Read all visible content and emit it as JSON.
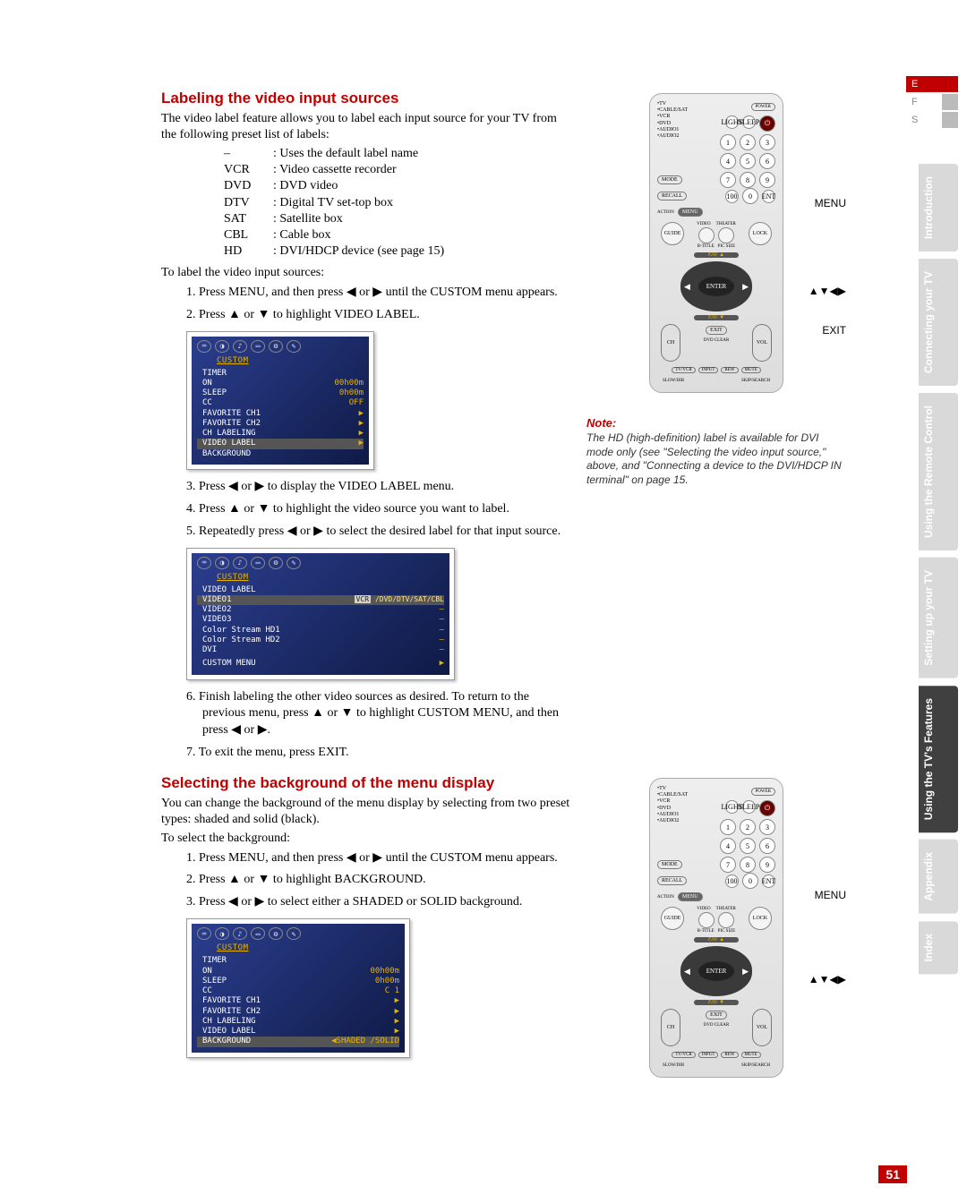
{
  "page_number": "51",
  "lang": {
    "e": "E",
    "f": "F",
    "s": "S"
  },
  "tabs": {
    "intro": "Introduction",
    "connect": "Connecting your TV",
    "remote": "Using the Remote Control",
    "setup": "Setting up your TV",
    "features": "Using the TV's Features",
    "appendix": "Appendix",
    "index": "Index"
  },
  "sec1": {
    "h": "Labeling the video input sources",
    "p": "The video label feature allows you to label each input source for your TV from the following preset list of labels:",
    "labels": [
      {
        "k": "–",
        "v": ": Uses the default label name"
      },
      {
        "k": "VCR",
        "v": ": Video cassette recorder"
      },
      {
        "k": "DVD",
        "v": ": DVD video"
      },
      {
        "k": "DTV",
        "v": ": Digital TV set-top box"
      },
      {
        "k": "SAT",
        "v": ": Satellite box"
      },
      {
        "k": "CBL",
        "v": ": Cable box"
      },
      {
        "k": "HD",
        "v": ": DVI/HDCP device (see page 15)"
      }
    ],
    "instr": "To label the video input sources:",
    "steps": {
      "s1": "1.  Press MENU, and then press ◀ or ▶ until the CUSTOM menu appears.",
      "s2": "2.  Press ▲ or ▼ to highlight VIDEO LABEL.",
      "s3": "3.  Press ◀ or ▶ to display the VIDEO LABEL menu.",
      "s4": "4.  Press ▲ or ▼ to highlight the video source you want to label.",
      "s5": "5.  Repeatedly press ◀ or ▶ to select the desired label for that input source.",
      "s6": "6.  Finish labeling the other video sources as desired. To return to the previous menu, press ▲ or ▼ to highlight CUSTOM MENU, and then press ◀ or ▶.",
      "s7": "7.  To exit the menu, press EXIT."
    }
  },
  "menu1": {
    "title": "CUSTOM",
    "lines": [
      [
        "TIMER",
        ""
      ],
      [
        "  ON",
        "00h00m"
      ],
      [
        "  SLEEP",
        "0h00m"
      ],
      [
        "CC",
        "OFF"
      ],
      [
        "FAVORITE CH1",
        "▶"
      ],
      [
        "FAVORITE CH2",
        "▶"
      ],
      [
        "CH LABELING",
        "▶"
      ],
      [
        "VIDEO LABEL",
        "▶"
      ],
      [
        "BACKGROUND",
        ""
      ]
    ],
    "highlight_index": 7
  },
  "menu2": {
    "title": "CUSTOM",
    "sub": "VIDEO   LABEL",
    "opts": "VCR /DVD/DTV/SAT/CBL",
    "lines": [
      "VIDEO1",
      "VIDEO2",
      "VIDEO3",
      "Color Stream  HD1",
      "Color Stream  HD2",
      "DVI"
    ],
    "foot": "CUSTOM MENU"
  },
  "menu3": {
    "title": "CUSTOM",
    "lines": [
      [
        "TIMER",
        ""
      ],
      [
        "  ON",
        "00h00m"
      ],
      [
        "  SLEEP",
        "0h00m"
      ],
      [
        "CC",
        "C 1"
      ],
      [
        "FAVORITE CH1",
        "▶"
      ],
      [
        "FAVORITE CH2",
        "▶"
      ],
      [
        "CH LABELING",
        "▶"
      ],
      [
        "VIDEO LABEL",
        "▶"
      ],
      [
        "BACKGROUND",
        "◀SHADED /SOLID"
      ]
    ],
    "highlight_index": 8
  },
  "remote": {
    "modes": "•TV\n•CABLE/SAT\n•VCR\n•DVD\n•AUDIO1\n•AUDIO2",
    "light": "LIGHT",
    "sleep": "SLEEP",
    "power": "POWER",
    "mode": "MODE",
    "recall": "RECALL",
    "n100": "100",
    "n0": "0",
    "ent": "ENT",
    "action": "ACTION",
    "menu_btn": "MENU",
    "video": "VIDEO",
    "theater": "THEATER",
    "guide": "GUIDE",
    "lock": "LOCK",
    "r_title": "R-TITLE",
    "size": "PIC SIZE",
    "fav": "FAV ▲",
    "enter": "ENTER",
    "fav_d": "FAV ▼",
    "ch": "CH",
    "vol": "VOL",
    "exit_b": "EXIT",
    "cap_menu": "MENU",
    "cap_arrows": "▲▼◀▶",
    "cap_exit": "EXIT",
    "dvdclear": "DVD CLEAR",
    "bottom": [
      "TV/VCR",
      "INPUT",
      "REW",
      "MUTE"
    ],
    "bottom2": [
      "SLOW/DIR",
      "",
      "SKIP/SEARCH",
      ""
    ]
  },
  "note": {
    "h": "Note:",
    "body": "The HD (high-definition) label is available for DVI mode only (see \"Selecting the video input source,\" above, and \"Connecting a device to the DVI/HDCP IN terminal\" on page 15."
  },
  "sec2": {
    "h": "Selecting the background of the menu display",
    "p": "You can change the background of the menu display by selecting from two preset types: shaded and solid (black).",
    "instr": "To select the background:",
    "steps": {
      "s1": "1.  Press MENU, and then press ◀ or ▶ until the CUSTOM menu appears.",
      "s2": "2.  Press ▲ or ▼ to highlight BACKGROUND.",
      "s3": "3.  Press ◀ or ▶ to select either a SHADED or SOLID background."
    }
  },
  "remote2": {
    "cap_menu": "MENU",
    "cap_arrows": "▲▼◀▶"
  }
}
